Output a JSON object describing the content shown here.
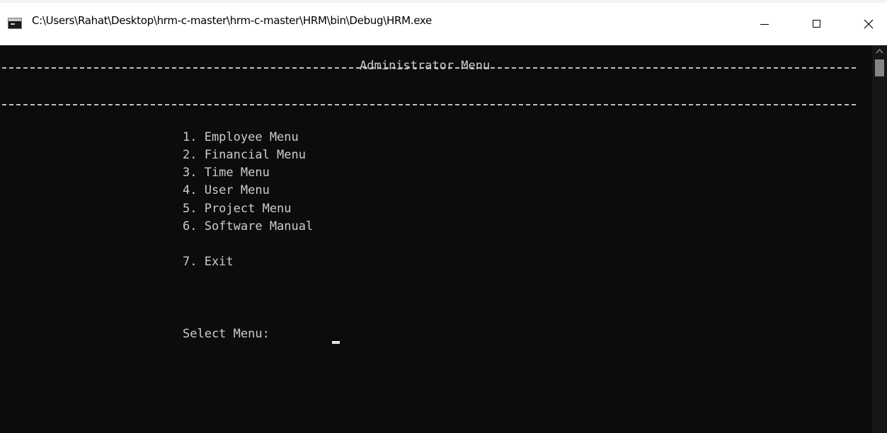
{
  "window": {
    "title": "C:\\Users\\Rahat\\Desktop\\hrm-c-master\\hrm-c-master\\HRM\\bin\\Debug\\HRM.exe",
    "icon": "console-app-icon",
    "controls": [
      "minimize-icon",
      "maximize-icon",
      "close-icon"
    ]
  },
  "console": {
    "header": "Administrator Menu",
    "menu_items": [
      "1. Employee Menu",
      "2. Financial Menu",
      "3. Time Menu",
      "4. User Menu",
      "5. Project Menu",
      "6. Software Manual"
    ],
    "exit_item": "7. Exit",
    "prompt": "Select Menu:"
  },
  "colors": {
    "console_background": "#0c0c0c",
    "console_text": "#cccccc",
    "titlebar_background": "#ffffff"
  }
}
